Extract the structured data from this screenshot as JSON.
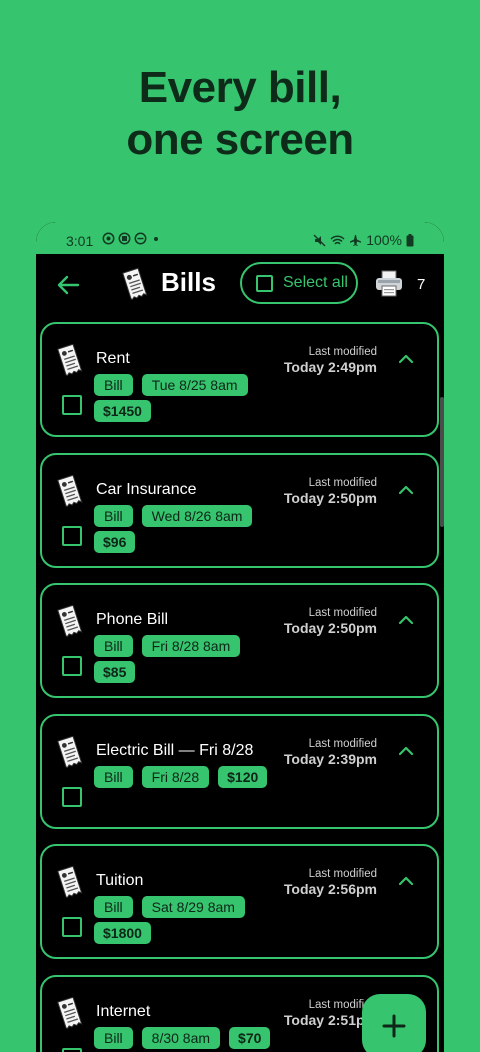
{
  "headline": {
    "line1": "Every bill,",
    "line2": "one screen"
  },
  "status_bar": {
    "time": "3:01",
    "battery": "100%"
  },
  "app_bar": {
    "title": "Bills",
    "select_all_label": "Select all",
    "count": "7"
  },
  "bills": [
    {
      "name": "Rent",
      "type": "Bill",
      "date": "Tue 8/25 8am",
      "amount": "$1450",
      "last_modified_label": "Last modified",
      "last_modified": "Today 2:49pm"
    },
    {
      "name": "Car Insurance",
      "type": "Bill",
      "date": "Wed 8/26 8am",
      "amount": "$96",
      "last_modified_label": "Last modified",
      "last_modified": "Today 2:50pm"
    },
    {
      "name": "Phone Bill",
      "type": "Bill",
      "date": "Fri 8/28 8am",
      "amount": "$85",
      "last_modified_label": "Last modified",
      "last_modified": "Today 2:50pm"
    },
    {
      "name": "Electric Bill — Fri 8/28",
      "type": "Bill",
      "date": "Fri 8/28",
      "amount": "$120",
      "last_modified_label": "Last modified",
      "last_modified": "Today 2:39pm"
    },
    {
      "name": "Tuition",
      "type": "Bill",
      "date": "Sat 8/29 8am",
      "amount": "$1800",
      "last_modified_label": "Last modified",
      "last_modified": "Today 2:56pm"
    },
    {
      "name": "Internet",
      "type": "Bill",
      "date": "8/30 8am",
      "amount": "$70",
      "last_modified_label": "Last modified",
      "last_modified": "Today 2:51pm"
    }
  ],
  "fab": {
    "icon": "plus-icon",
    "label": "+"
  },
  "colors": {
    "accent": "#36c46e",
    "background": "#000000",
    "headline": "#0e2a19"
  }
}
